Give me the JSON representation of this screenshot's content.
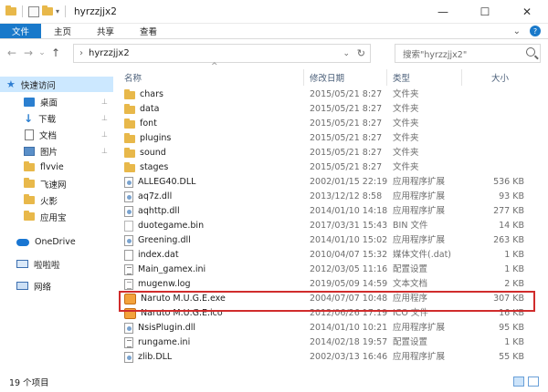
{
  "window": {
    "title": "hyrzzjjx2",
    "controls": {
      "minimize": "—",
      "maximize": "☐",
      "close": "✕"
    }
  },
  "ribbon": {
    "tabs": [
      "文件",
      "主页",
      "共享",
      "查看"
    ],
    "expand_glyph": "⌄",
    "help_glyph": "?"
  },
  "addressbar": {
    "back": "←",
    "forward": "→",
    "recent": "⌄",
    "up": "↑",
    "breadcrumb_sep": "›",
    "path": "hyrzzjjx2",
    "dropdown": "⌄",
    "refresh": "↻"
  },
  "search": {
    "placeholder": "搜索\"hyrzzjjx2\""
  },
  "navpane": {
    "items": [
      {
        "label": "快速访问",
        "icon": "star-icon",
        "selected": true
      },
      {
        "label": "桌面",
        "icon": "desktop-icon",
        "pinned": true
      },
      {
        "label": "下载",
        "icon": "download-icon",
        "pinned": true
      },
      {
        "label": "文档",
        "icon": "document-icon",
        "pinned": true
      },
      {
        "label": "图片",
        "icon": "pictures-icon",
        "pinned": true
      },
      {
        "label": "flvvie",
        "icon": "folder-icon"
      },
      {
        "label": "飞速网",
        "icon": "folder-icon"
      },
      {
        "label": "火影",
        "icon": "folder-icon"
      },
      {
        "label": "应用宝",
        "icon": "folder-icon"
      },
      {
        "label": "OneDrive",
        "icon": "onedrive-icon"
      },
      {
        "label": "啦啦啦",
        "icon": "computer-icon"
      },
      {
        "label": "网络",
        "icon": "network-icon"
      }
    ],
    "pin_glyph": "📌"
  },
  "filelist": {
    "columns": {
      "name": "名称",
      "date": "修改日期",
      "type": "类型",
      "size": "大小"
    },
    "sort_caret": "^",
    "rows": [
      {
        "name": "chars",
        "date": "2015/05/21 8:27",
        "type": "文件夹",
        "size": "",
        "icon": "folder-icon"
      },
      {
        "name": "data",
        "date": "2015/05/21 8:27",
        "type": "文件夹",
        "size": "",
        "icon": "folder-icon"
      },
      {
        "name": "font",
        "date": "2015/05/21 8:27",
        "type": "文件夹",
        "size": "",
        "icon": "folder-icon"
      },
      {
        "name": "plugins",
        "date": "2015/05/21 8:27",
        "type": "文件夹",
        "size": "",
        "icon": "folder-icon"
      },
      {
        "name": "sound",
        "date": "2015/05/21 8:27",
        "type": "文件夹",
        "size": "",
        "icon": "folder-icon"
      },
      {
        "name": "stages",
        "date": "2015/05/21 8:27",
        "type": "文件夹",
        "size": "",
        "icon": "folder-icon"
      },
      {
        "name": "ALLEG40.DLL",
        "date": "2002/01/15 22:19",
        "type": "应用程序扩展",
        "size": "536 KB",
        "icon": "dll-icon"
      },
      {
        "name": "aq7z.dll",
        "date": "2013/12/12 8:58",
        "type": "应用程序扩展",
        "size": "93 KB",
        "icon": "dll-icon"
      },
      {
        "name": "aqhttp.dll",
        "date": "2014/01/10 14:18",
        "type": "应用程序扩展",
        "size": "277 KB",
        "icon": "dll-icon"
      },
      {
        "name": "duotegame.bin",
        "date": "2017/03/31 15:43",
        "type": "BIN 文件",
        "size": "14 KB",
        "icon": "bin-icon"
      },
      {
        "name": "Greening.dll",
        "date": "2014/01/10 15:02",
        "type": "应用程序扩展",
        "size": "263 KB",
        "icon": "dll-icon"
      },
      {
        "name": "index.dat",
        "date": "2010/04/07 15:32",
        "type": "媒体文件(.dat)",
        "size": "1 KB",
        "icon": "file-icon"
      },
      {
        "name": "Main_gamex.ini",
        "date": "2012/03/05 11:16",
        "type": "配置设置",
        "size": "1 KB",
        "icon": "config-icon"
      },
      {
        "name": "mugenw.log",
        "date": "2019/05/09 14:59",
        "type": "文本文档",
        "size": "2 KB",
        "icon": "text-icon"
      },
      {
        "name": "Naruto M.U.G.E.exe",
        "date": "2004/07/07 10:48",
        "type": "应用程序",
        "size": "307 KB",
        "icon": "naruto-exe-icon"
      },
      {
        "name": "Naruto M.U.G.E.ico",
        "date": "2012/06/26 17:19",
        "type": "ICO 文件",
        "size": "16 KB",
        "icon": "naruto-ico-icon"
      },
      {
        "name": "NsisPlugin.dll",
        "date": "2014/01/10 10:21",
        "type": "应用程序扩展",
        "size": "95 KB",
        "icon": "dll-icon"
      },
      {
        "name": "rungame.ini",
        "date": "2014/02/18 19:57",
        "type": "配置设置",
        "size": "1 KB",
        "icon": "config-icon"
      },
      {
        "name": "zlib.DLL",
        "date": "2002/03/13 16:46",
        "type": "应用程序扩展",
        "size": "55 KB",
        "icon": "dll-icon"
      }
    ],
    "highlighted_row": "Naruto M.U.G.E.exe",
    "highlight_color": "#d02c2c"
  },
  "statusbar": {
    "text": "19 个项目"
  },
  "colors": {
    "accent": "#1979ca",
    "folder": "#e8b84a",
    "selected_bg": "#cce8ff"
  }
}
